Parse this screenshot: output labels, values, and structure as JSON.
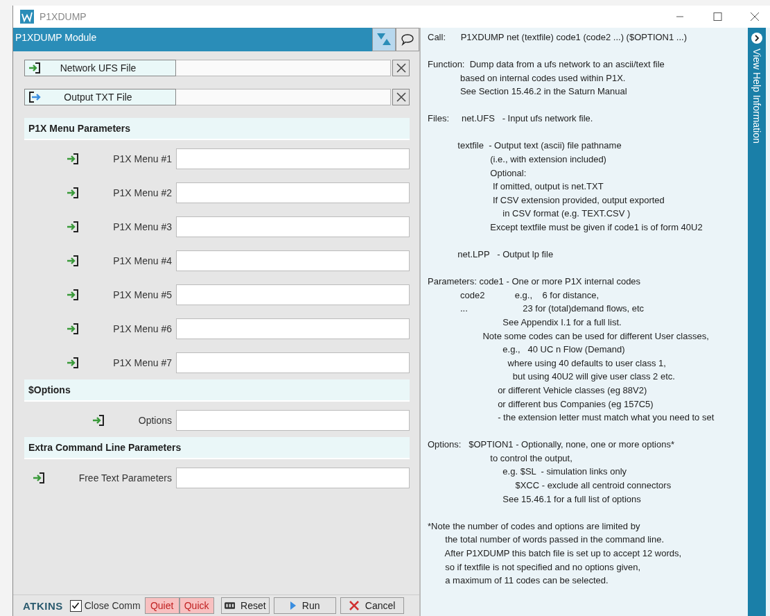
{
  "window": {
    "title": "P1XDUMP"
  },
  "module": {
    "title": "P1XDUMP Module"
  },
  "file_rows": [
    {
      "kind": "input",
      "label": "Network UFS File"
    },
    {
      "kind": "output",
      "label": "Output TXT File"
    }
  ],
  "sections": [
    {
      "title": "P1X Menu Parameters",
      "fields": [
        {
          "label": "P1X Menu #1"
        },
        {
          "label": "P1X Menu #2"
        },
        {
          "label": "P1X Menu #3"
        },
        {
          "label": "P1X Menu #4"
        },
        {
          "label": "P1X Menu #5"
        },
        {
          "label": "P1X Menu #6"
        },
        {
          "label": "P1X Menu #7"
        }
      ]
    },
    {
      "title": "$Options",
      "fields": [
        {
          "label": "Options"
        }
      ]
    },
    {
      "title": "Extra Command Line Parameters",
      "fields": [
        {
          "label": "Free Text Parameters"
        }
      ]
    }
  ],
  "footer": {
    "logo": "ATKINS",
    "close_checkbox": {
      "label": "Close Comm",
      "checked": true
    },
    "buttons": [
      {
        "kind": "quiet",
        "label": "Quiet"
      },
      {
        "kind": "quick",
        "label": "Quick"
      },
      {
        "kind": "reset",
        "label": "Reset"
      },
      {
        "kind": "run",
        "label": "Run"
      },
      {
        "kind": "cancel",
        "label": "Cancel"
      }
    ]
  },
  "help": {
    "tab_label": "View Help Information",
    "paragraphs": [
      [
        "Call:      P1XDUMP net (textfile) code1 (code2 ...) ($OPTION1 ...)"
      ],
      [
        "Function:  Dump data from a ufs network to an ascii/text file",
        "             based on internal codes used within P1X.",
        "             See Section 15.46.2 in the Saturn Manual"
      ],
      [
        "Files:     net.UFS   - Input ufs network file."
      ],
      [
        "            textfile  - Output text (ascii) file pathname",
        "                         (i.e., with extension included)",
        "                         Optional:",
        "                          If omitted, output is net.TXT",
        "                          If CSV extension provided, output exported",
        "                              in CSV format (e.g. TEXT.CSV )",
        "                         Except textfile must be given if code1 is of form 40U2"
      ],
      [
        "            net.LPP   - Output lp file"
      ],
      [
        "Parameters: code1 - One or more P1X internal codes",
        "             code2            e.g.,    6 for distance,",
        "             ...                      23 for (total)demand flows, etc",
        "                              See Appendix I.1 for a full list.",
        "                      Note some codes can be used for different User classes,",
        "                              e.g.,   40 UC n Flow (Demand)",
        "                                where using 40 defaults to user class 1,",
        "                                  but using 40U2 will give user class 2 etc.",
        "                            or different Vehicle classes (eg 88V2)",
        "                            or different bus Companies (eg 157C5)",
        "                            - the extension letter must match what you need to set"
      ],
      [
        "Options:   $OPTION1 - Optionally, none, one or more options*",
        "                         to control the output,",
        "                              e.g. $SL  - simulation links only",
        "                                   $XCC - exclude all centroid connectors",
        "                              See 15.46.1 for a full list of options"
      ],
      [
        "*Note the number of codes and options are limited by",
        "       the total number of words passed in the command line.",
        "       After P1XDUMP this batch file is set up to accept 12 words,",
        "       so if textfile is not specified and no options given,",
        "       a maximum of 11 codes can be selected."
      ]
    ]
  }
}
